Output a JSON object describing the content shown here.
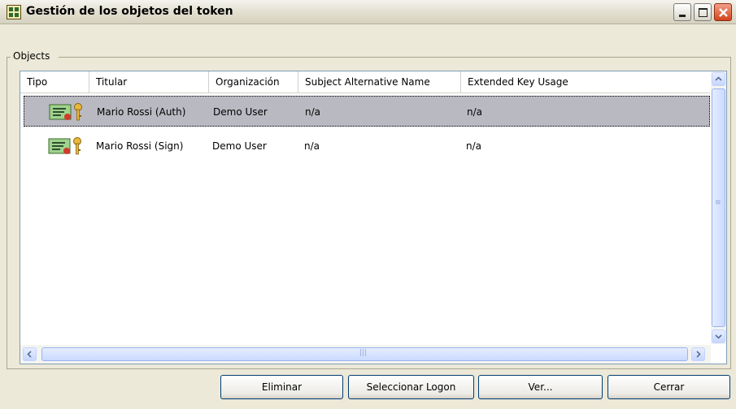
{
  "window": {
    "title": "Gestión de los objetos del token",
    "controls": {
      "minimize": "minimize-icon",
      "maximize": "maximize-icon",
      "close": "close-icon"
    }
  },
  "group": {
    "label": "Objects"
  },
  "table": {
    "columns": [
      "Tipo",
      "Titular",
      "Organización",
      "Subject Alternative Name",
      "Extended Key Usage"
    ],
    "rows": [
      {
        "titular": "Mario Rossi (Auth)",
        "organizacion": "Demo User",
        "san": "n/a",
        "eku": "n/a",
        "icon": "certificate-key-icon",
        "selected": true
      },
      {
        "titular": "Mario Rossi (Sign)",
        "organizacion": "Demo User",
        "san": "n/a",
        "eku": "n/a",
        "icon": "certificate-key-icon",
        "selected": false
      }
    ],
    "selected_color": "#b9b9c2"
  },
  "buttons": {
    "eliminar": "Eliminar",
    "seleccionar_logon": "Seleccionar Logon",
    "ver": "Ver...",
    "cerrar": "Cerrar"
  },
  "colors": {
    "window_bg": "#ece9d8",
    "close_button": "#d3431b",
    "button_border": "#003c74"
  }
}
